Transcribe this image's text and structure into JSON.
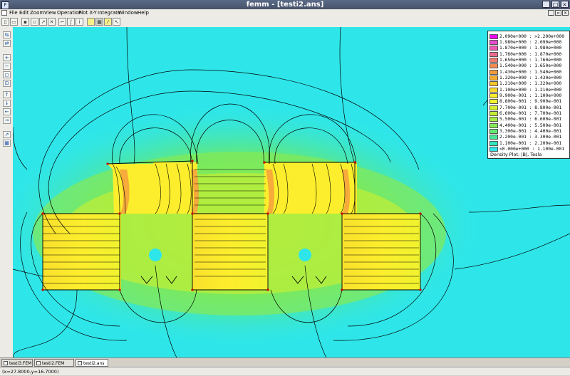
{
  "window": {
    "title": "femm - [testi2.ans]",
    "system_icon": "femm-app-icon"
  },
  "menu": [
    "File",
    "Edit",
    "Zoom",
    "View",
    "Operation",
    "Plot X-Y",
    "Integrate",
    "Window",
    "Help"
  ],
  "legend": {
    "rows": [
      {
        "label": "2.090e+000 : >2.200e+000",
        "color": "#f000f0"
      },
      {
        "label": "1.980e+000 : 2.090e+000",
        "color": "#e84ad0"
      },
      {
        "label": "1.870e+000 : 1.980e+000",
        "color": "#ea5ab2"
      },
      {
        "label": "1.760e+000 : 1.870e+000",
        "color": "#ee6a8e"
      },
      {
        "label": "1.650e+000 : 1.760e+000",
        "color": "#f07a70"
      },
      {
        "label": "1.540e+000 : 1.650e+000",
        "color": "#f28a52"
      },
      {
        "label": "1.430e+000 : 1.540e+000",
        "color": "#f49a3e"
      },
      {
        "label": "1.320e+000 : 1.430e+000",
        "color": "#f6ac30"
      },
      {
        "label": "1.210e+000 : 1.320e+000",
        "color": "#f8c22a"
      },
      {
        "label": "1.100e+000 : 1.210e+000",
        "color": "#fad82a"
      },
      {
        "label": "9.900e-001 : 1.100e+000",
        "color": "#fcee2c"
      },
      {
        "label": "8.800e-001 : 9.900e-001",
        "color": "#f0f22e"
      },
      {
        "label": "7.700e-001 : 8.800e-001",
        "color": "#d8f030"
      },
      {
        "label": "6.600e-001 : 7.700e-001",
        "color": "#c2ee36"
      },
      {
        "label": "5.500e-001 : 6.600e-001",
        "color": "#a4ec44"
      },
      {
        "label": "4.400e-001 : 5.500e-001",
        "color": "#84ea56"
      },
      {
        "label": "3.300e-001 : 4.400e-001",
        "color": "#64e872"
      },
      {
        "label": "2.200e-001 : 3.300e-001",
        "color": "#48e694"
      },
      {
        "label": "1.100e-001 : 2.200e-001",
        "color": "#34e6bc"
      },
      {
        "label": "<0.000e+000 : 1.100e-001",
        "color": "#2ee6e6"
      }
    ],
    "title": "Density Plot: |B|, Tesla"
  },
  "tabs": [
    "testi3.FEM",
    "testi2.FEM",
    "testi2.ans"
  ],
  "active_tab": "testi2.ans",
  "status": "(x=27.8000,y=16.7000)",
  "plot_colors": {
    "low": "#2ee6ea",
    "mid": "#48e694",
    "green": "#84ea56",
    "yellow": "#fcee2c",
    "orange": "#f49a3e"
  }
}
